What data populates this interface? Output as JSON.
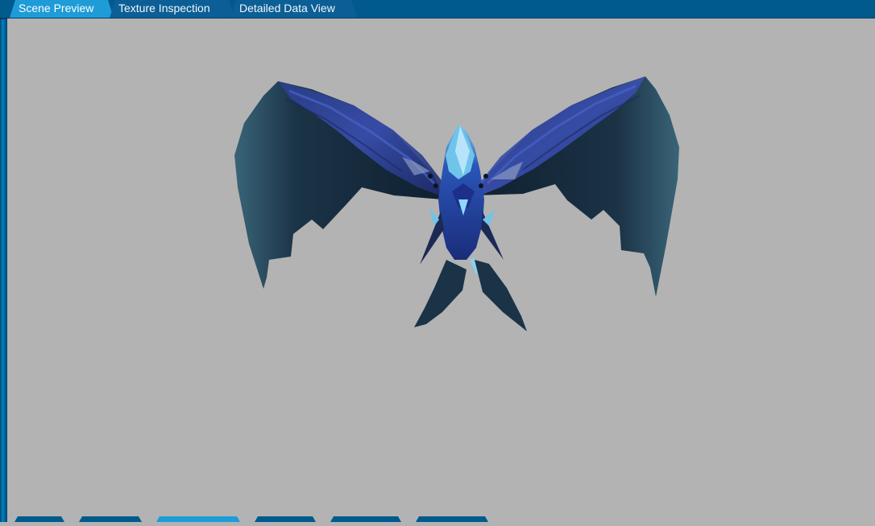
{
  "tabs": [
    {
      "label": "Scene Preview",
      "active": true
    },
    {
      "label": "Texture Inspection",
      "active": false
    },
    {
      "label": "Detailed Data View",
      "active": false
    }
  ],
  "viewport": {
    "background": "#b3b3b3",
    "model": "winged-dragon-creature"
  },
  "bottom_tabs": [
    {
      "active": false
    },
    {
      "active": false
    },
    {
      "active": true
    },
    {
      "active": false
    },
    {
      "active": false
    },
    {
      "active": false
    }
  ],
  "colors": {
    "tabbar": "#005a8c",
    "tab_active": "#1e9cd8",
    "tab_inactive": "#0b5f96",
    "text": "#f2f6fa"
  }
}
